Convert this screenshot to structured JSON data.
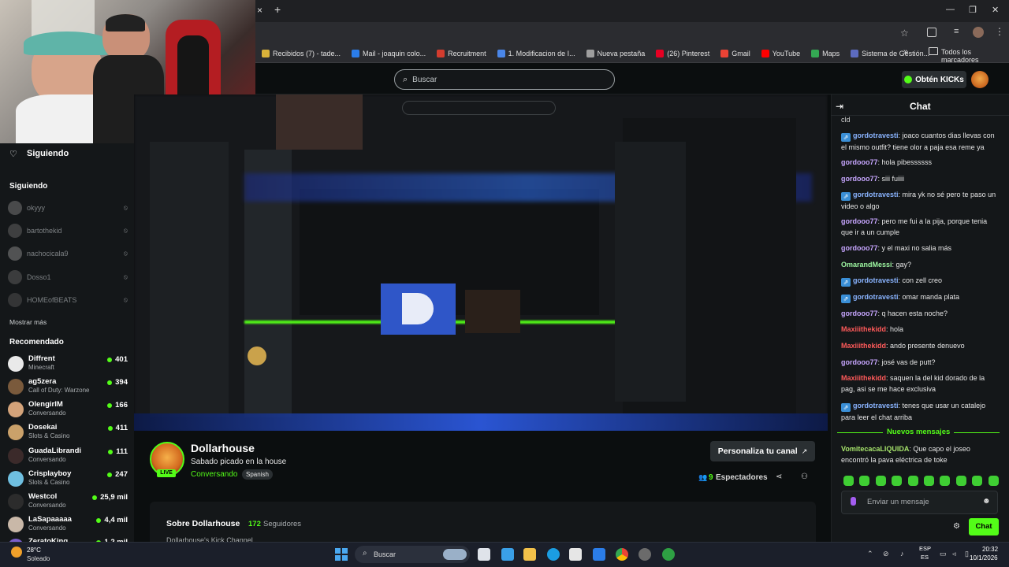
{
  "browser": {
    "new_tab_label": "+",
    "close_tab_label": "×",
    "bookmarks": [
      {
        "label": "Recibidos (7) - tade...",
        "color": "#d9b23a"
      },
      {
        "label": "Mail - joaquin colo...",
        "color": "#2b7de9"
      },
      {
        "label": "Recruitment",
        "color": "#d33c2e"
      },
      {
        "label": "1. Modificacion de I...",
        "color": "#4a86e8"
      },
      {
        "label": "Nueva pestaña",
        "color": "#9e9e9e"
      },
      {
        "label": "(26) Pinterest",
        "color": "#e60023"
      },
      {
        "label": "Gmail",
        "color": "#ea4335"
      },
      {
        "label": "YouTube",
        "color": "#ff0000"
      },
      {
        "label": "Maps",
        "color": "#34a853"
      },
      {
        "label": "Sistema de Gestión...",
        "color": "#5c6bc0"
      }
    ],
    "bookmarks_more": "»",
    "all_bookmarks": "Todos los marcadores"
  },
  "header": {
    "search_placeholder": "Buscar",
    "kicks_button": "Obtén KICKs"
  },
  "sidebar": {
    "following_title": "Siguiendo",
    "following_section": "Siguiendo",
    "following": [
      {
        "name": "okyyy"
      },
      {
        "name": "bartothekid"
      },
      {
        "name": "nachocicala9"
      },
      {
        "name": "Dosso1"
      },
      {
        "name": "HOMEofBEATS"
      }
    ],
    "show_more": "Mostrar más",
    "recommended_title": "Recomendado",
    "recommended": [
      {
        "name": "Diffrent",
        "category": "Minecraft",
        "viewers": "401",
        "color": "#e9e9e9"
      },
      {
        "name": "ag5zera",
        "category": "Call of Duty: Warzone",
        "viewers": "394",
        "color": "#7a5a3c"
      },
      {
        "name": "OlengirIM",
        "category": "Conversando",
        "viewers": "166",
        "color": "#d4a37a"
      },
      {
        "name": "Dosekai",
        "category": "Slots & Casino",
        "viewers": "411",
        "color": "#caa16a"
      },
      {
        "name": "GuadaLibrandi",
        "category": "Conversando",
        "viewers": "111",
        "color": "#3b2a2a"
      },
      {
        "name": "Crisplayboy",
        "category": "Slots & Casino",
        "viewers": "247",
        "color": "#6fbfe0"
      },
      {
        "name": "Westcol",
        "category": "Conversando",
        "viewers": "25,9 mil",
        "color": "#2c2c2c"
      },
      {
        "name": "LaSapaaaaa",
        "category": "Conversando",
        "viewers": "4,4 mil",
        "color": "#c9b8a8"
      },
      {
        "name": "ZeratoKing",
        "category": "",
        "viewers": "1,2 mil",
        "color": "#7a5ec9"
      }
    ]
  },
  "stream": {
    "channel": "Dollarhouse",
    "title": "Sabado picado en la house",
    "category": "Conversando",
    "language": "Spanish",
    "live_badge": "LIVE",
    "personalize_button": "Personaliza tu canal",
    "viewers_count": "9",
    "viewers_label": "Espectadores",
    "about_title": "Sobre Dollarhouse",
    "followers_count": "172",
    "followers_label": "Seguidores",
    "about_text": "Dollarhouse's Kick Channel"
  },
  "chat": {
    "title": "Chat",
    "top_fragment": "cld",
    "new_messages": "Nuevos mensajes",
    "input_placeholder": "Enviar un mensaje",
    "send_button": "Chat",
    "messages": [
      {
        "user": "gordotravesti",
        "text": ": joaco cuantos dias llevas con el mismo outfit? tiene olor a paja esa reme ya",
        "color": "#8ab4ff",
        "badge": true
      },
      {
        "user": "gordooo77",
        "text": ": hola pibessssss",
        "color": "#c7a6ff",
        "badge": false
      },
      {
        "user": "gordooo77",
        "text": ": siii fuiiii",
        "color": "#c7a6ff",
        "badge": false
      },
      {
        "user": "gordotravesti",
        "text": ": mira yk no sé pero te paso un video o algo",
        "color": "#8ab4ff",
        "badge": true
      },
      {
        "user": "gordooo77",
        "text": ": pero me fui a la pija, porque tenia que ir a un cumple",
        "color": "#c7a6ff",
        "badge": false
      },
      {
        "user": "gordooo77",
        "text": ": y el maxi no salia más",
        "color": "#c7a6ff",
        "badge": false
      },
      {
        "user": "OmarandMessi",
        "text": ": gay?",
        "color": "#9cf5a0",
        "badge": false
      },
      {
        "user": "gordotravesti",
        "text": ": con zell creo",
        "color": "#8ab4ff",
        "badge": true
      },
      {
        "user": "gordotravesti",
        "text": ": omar manda plata",
        "color": "#8ab4ff",
        "badge": true
      },
      {
        "user": "gordooo77",
        "text": ": q hacen esta noche?",
        "color": "#c7a6ff",
        "badge": false
      },
      {
        "user": "Maxiiithekidd",
        "text": ": hola",
        "color": "#ff5a5a",
        "badge": false
      },
      {
        "user": "Maxiiithekidd",
        "text": ": ando presente denuevo",
        "color": "#ff5a5a",
        "badge": false
      },
      {
        "user": "gordooo77",
        "text": ": josé vas de putt?",
        "color": "#c7a6ff",
        "badge": false
      },
      {
        "user": "Maxiiithekidd",
        "text": ": saquen la del kid dorado de la pag, asi se me hace exclusiva",
        "color": "#ff5a5a",
        "badge": false
      },
      {
        "user": "gordotravesti",
        "text": ": tenes que usar un catalejo para leer el chat arriba",
        "color": "#8ab4ff",
        "badge": true
      }
    ],
    "new_message": {
      "user": "VomitecacaLIQUIDA",
      "text": ": Que capo el joseo encontró la pava eléctrica de toke",
      "color": "#a6e36b"
    }
  },
  "taskbar": {
    "weather_temp": "28°C",
    "weather_desc": "Soleado",
    "search_label": "Buscar",
    "lang_top": "ESP",
    "lang_bottom": "ES",
    "time": "20:32",
    "date": "10/1/2026"
  }
}
